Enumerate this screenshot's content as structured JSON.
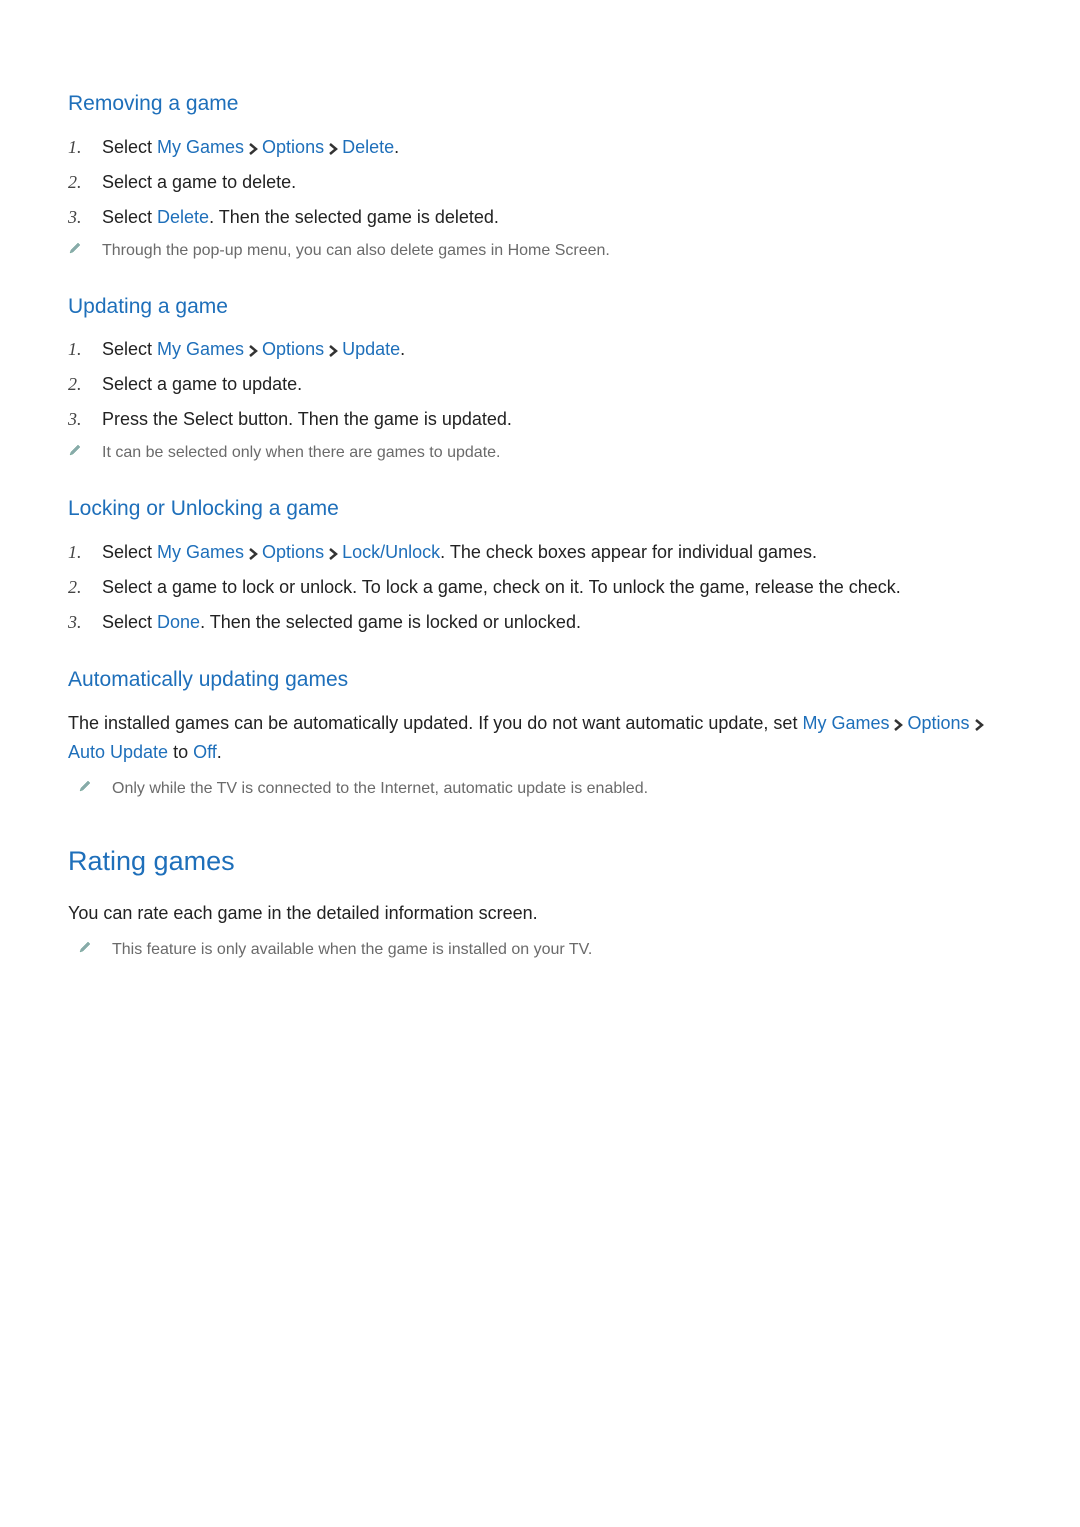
{
  "s1": {
    "title": "Removing a game",
    "step1_pre": "Select ",
    "step1_a": "My Games",
    "step1_b": "Options",
    "step1_c": "Delete",
    "step1_post": ".",
    "step2": "Select a game to delete.",
    "step3_pre": "Select ",
    "step3_a": "Delete",
    "step3_post": ". Then the selected game is deleted.",
    "note": "Through the pop-up menu, you can also delete games in Home Screen."
  },
  "s2": {
    "title": "Updating a game",
    "step1_pre": "Select ",
    "step1_a": "My Games",
    "step1_b": "Options",
    "step1_c": "Update",
    "step1_post": ".",
    "step2": "Select a game to update.",
    "step3": "Press the Select button. Then the game is updated.",
    "note": "It can be selected only when there are games to update."
  },
  "s3": {
    "title": "Locking or Unlocking a game",
    "step1_pre": "Select ",
    "step1_a": "My Games",
    "step1_b": "Options",
    "step1_c": "Lock/Unlock",
    "step1_post": ". The check boxes appear for individual games.",
    "step2": "Select a game to lock or unlock. To lock a game, check on it. To unlock the game, release the check.",
    "step3_pre": "Select ",
    "step3_a": "Done",
    "step3_post": ". Then the selected game is locked or unlocked."
  },
  "s4": {
    "title": "Automatically updating games",
    "para_pre": "The installed games can be automatically updated. If you do not want automatic update, set ",
    "para_a": "My Games",
    "para_b": "Options",
    "para_c": "Auto Update",
    "para_mid": " to ",
    "para_d": "Off",
    "para_post": ".",
    "note": "Only while the TV is connected to the Internet, automatic update is enabled."
  },
  "s5": {
    "title": "Rating games",
    "para": "You can rate each game in the detailed information screen.",
    "note": "This feature is only available when the game is installed on your TV."
  },
  "markers": {
    "m1": "1.",
    "m2": "2.",
    "m3": "3."
  },
  "colors": {
    "accent": "#1e6fba",
    "note": "#6a6a6a"
  }
}
